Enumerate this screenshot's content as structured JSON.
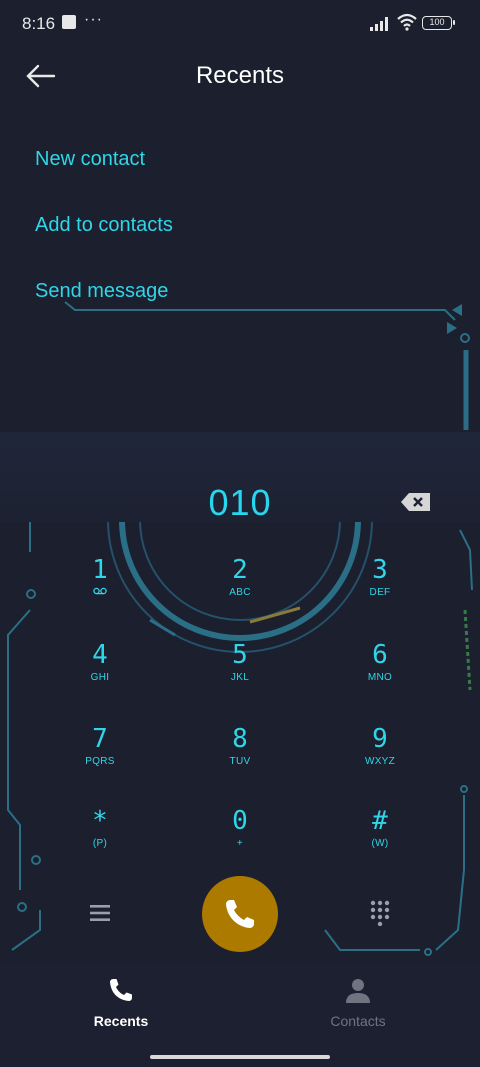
{
  "status": {
    "time": "8:16",
    "dots": "···",
    "battery": "100"
  },
  "header": {
    "title": "Recents"
  },
  "actions": [
    "New contact",
    "Add to contacts",
    "Send message"
  ],
  "dialer": {
    "number": "010"
  },
  "keys": [
    {
      "digit": "1",
      "letters": ""
    },
    {
      "digit": "2",
      "letters": "ABC"
    },
    {
      "digit": "3",
      "letters": "DEF"
    },
    {
      "digit": "4",
      "letters": "GHI"
    },
    {
      "digit": "5",
      "letters": "JKL"
    },
    {
      "digit": "6",
      "letters": "MNO"
    },
    {
      "digit": "7",
      "letters": "PQRS"
    },
    {
      "digit": "8",
      "letters": "TUV"
    },
    {
      "digit": "9",
      "letters": "WXYZ"
    },
    {
      "digit": "*",
      "letters": "(P)"
    },
    {
      "digit": "0",
      "letters": "+"
    },
    {
      "digit": "#",
      "letters": "(W)"
    }
  ],
  "nav": {
    "recents": "Recents",
    "contacts": "Contacts"
  },
  "colors": {
    "accent": "#2fd6e8",
    "call": "#ad7a00",
    "background": "#1b1f2e"
  }
}
